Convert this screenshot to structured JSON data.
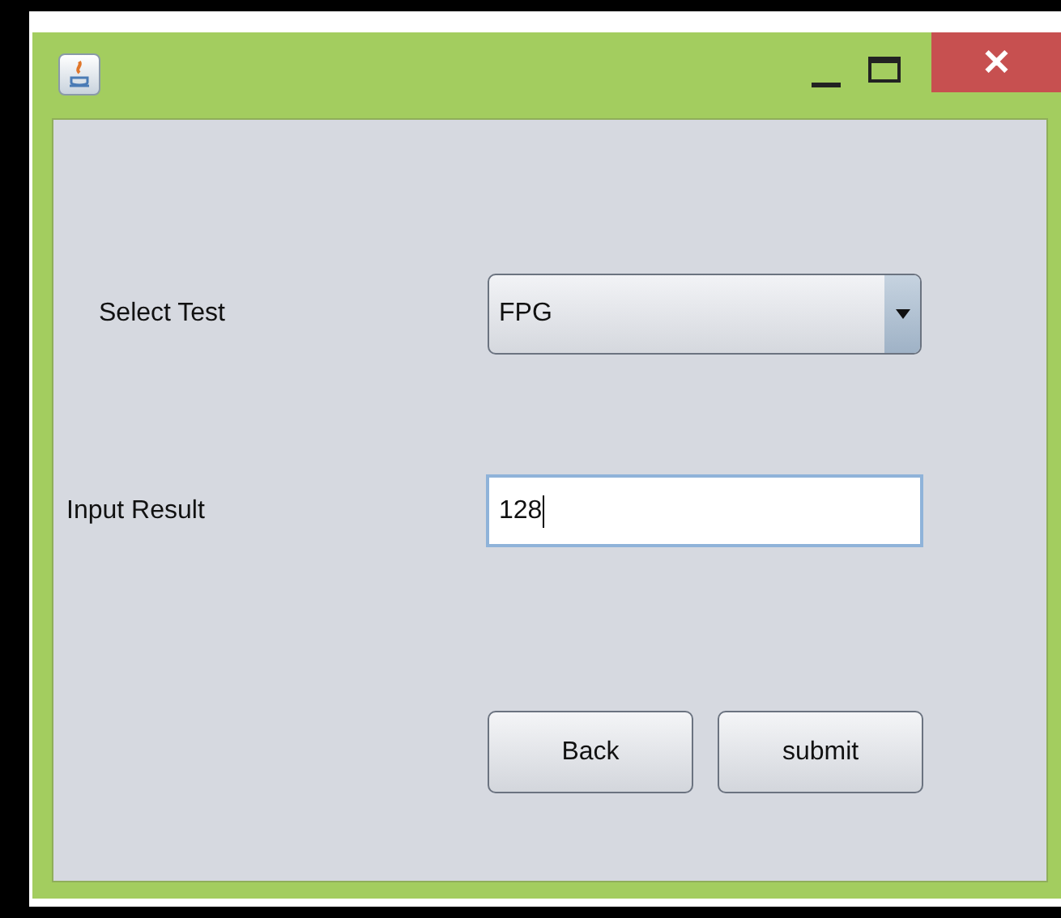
{
  "window": {
    "close_label": "✕"
  },
  "form": {
    "test_label": "Select Test",
    "test_value": "FPG",
    "result_label": "Input Result",
    "result_value": "128",
    "result_focused": true
  },
  "buttons": [
    "Back",
    "submit"
  ]
}
